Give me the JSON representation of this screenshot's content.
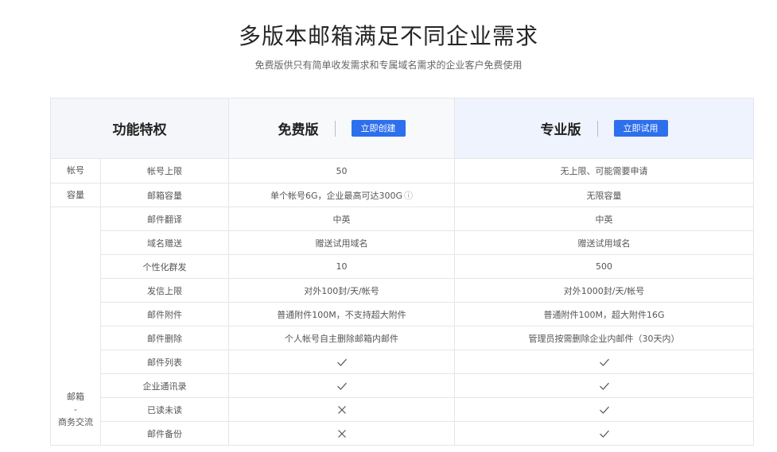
{
  "header": {
    "title": "多版本邮箱满足不同企业需求",
    "subtitle": "免费版供只有简单收发需求和专属域名需求的企业客户免费使用"
  },
  "table": {
    "feature_heading": "功能特权",
    "plans": [
      {
        "name": "免费版",
        "button": "立即创建"
      },
      {
        "name": "专业版",
        "button": "立即试用"
      }
    ],
    "categories": [
      {
        "label": "帐号",
        "rows": 1
      },
      {
        "label": "容量",
        "rows": 1
      },
      {
        "label": "邮箱\n-\n商务交流",
        "rows": 10
      }
    ],
    "rows": [
      {
        "feature": "帐号上限",
        "free": "50",
        "pro": "无上限、可能需要申请"
      },
      {
        "feature": "邮箱容量",
        "free": "单个帐号6G，企业最高可达300G",
        "free_info": "ⓘ",
        "pro": "无限容量"
      },
      {
        "feature": "邮件翻译",
        "free": "中英",
        "pro": "中英"
      },
      {
        "feature": "域名赠送",
        "free": "赠送试用域名",
        "pro": "赠送试用域名"
      },
      {
        "feature": "个性化群发",
        "free": "10",
        "pro": "500"
      },
      {
        "feature": "发信上限",
        "free": "对外100封/天/帐号",
        "pro": "对外1000封/天/帐号"
      },
      {
        "feature": "邮件附件",
        "free": "普通附件100M，不支持超大附件",
        "pro": "普通附件100M，超大附件16G"
      },
      {
        "feature": "邮件删除",
        "free": "个人帐号自主删除邮箱内邮件",
        "pro": "管理员按需删除企业内邮件（30天内）"
      },
      {
        "feature": "邮件列表",
        "free_icon": "check-icon",
        "pro_icon": "check-icon"
      },
      {
        "feature": "企业通讯录",
        "free_icon": "check-icon",
        "pro_icon": "check-icon"
      },
      {
        "feature": "已读未读",
        "free_icon": "cross-icon",
        "pro_icon": "check-icon"
      },
      {
        "feature": "邮件备份",
        "free_icon": "cross-icon",
        "pro_icon": "check-icon"
      }
    ]
  },
  "colors": {
    "accent": "#2d6fed",
    "pro_header_bg": "#eef3fd",
    "border": "#e3e6eb"
  }
}
